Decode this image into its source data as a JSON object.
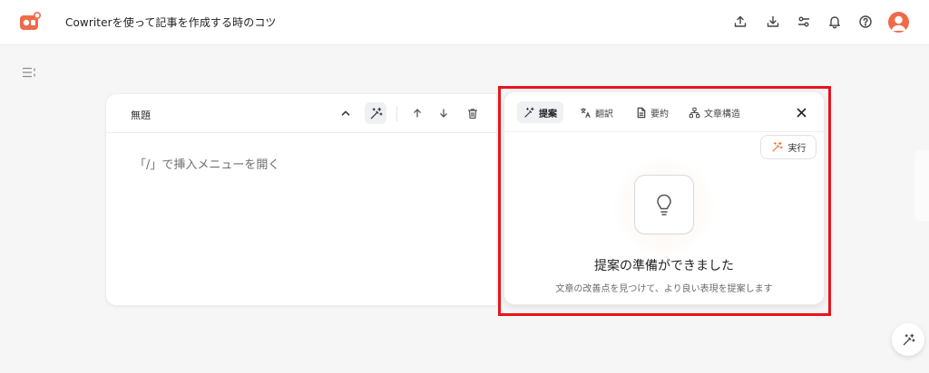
{
  "header": {
    "doc_title": "Cowriterを使って記事を作成する時のコツ",
    "icons": [
      "upload-icon",
      "download-icon",
      "settings-sliders-icon",
      "bell-icon",
      "help-icon"
    ],
    "brand_color": "#f06a4a"
  },
  "editor": {
    "block_title": "無題",
    "placeholder": "「/」で挿入メニューを開く"
  },
  "ai_panel": {
    "tabs": [
      {
        "label": "提案",
        "icon": "magic-wand-icon",
        "active": true
      },
      {
        "label": "翻訳",
        "icon": "translate-icon",
        "active": false
      },
      {
        "label": "要約",
        "icon": "document-icon",
        "active": false
      },
      {
        "label": "文章構造",
        "icon": "structure-icon",
        "active": false
      }
    ],
    "run_label": "実行",
    "empty_title": "提案の準備ができました",
    "empty_desc": "文章の改善点を見つけて、より良い表現を提案します"
  },
  "colors": {
    "highlight": "#e8141c",
    "accent": "#f07a3a"
  }
}
